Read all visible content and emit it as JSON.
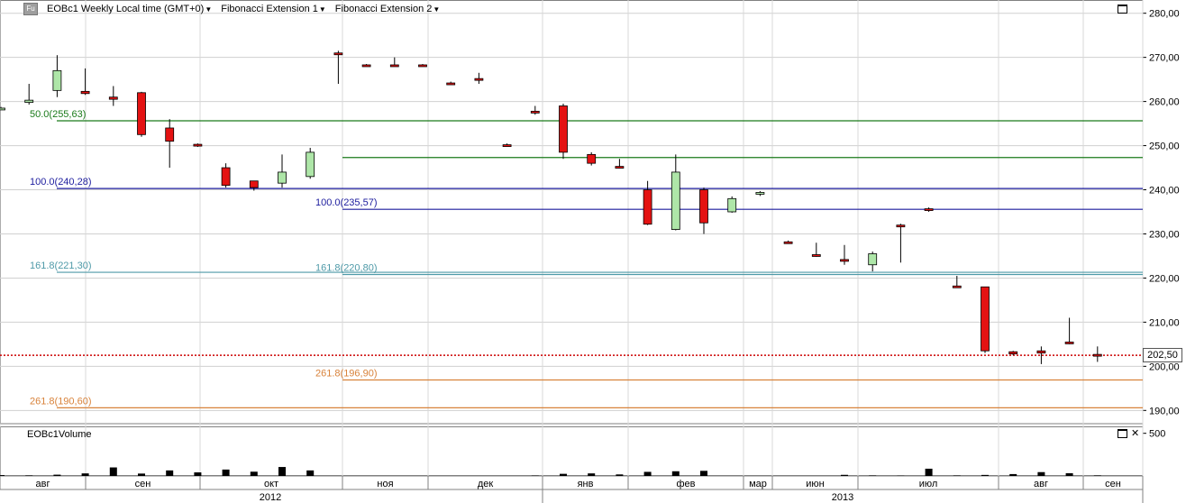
{
  "header": {
    "badge": "Fu",
    "symbol_title": "EOBc1 Weekly Local time (GMT+0)",
    "studies": [
      "Fibonacci Extension 1",
      "Fibonacci Extension 2"
    ]
  },
  "volume_title": "EOBc1Volume",
  "last_price_label": "202,50",
  "colors": {
    "up_fill": "#aee6a8",
    "down_fill": "#e41212",
    "fib50": "#1a7a1a",
    "fib100": "#1d1d9e",
    "fib161": "#4f9aa8",
    "fib261": "#d8823a",
    "last_price": "#cc0000",
    "grid": "#d0d0d0",
    "volume": "#000000"
  },
  "chart_data": {
    "type": "candlestick",
    "price_axis": {
      "ylim": [
        187,
        283
      ],
      "ticks": [
        "190,00",
        "200,00",
        "210,00",
        "220,00",
        "230,00",
        "240,00",
        "250,00",
        "260,00",
        "270,00",
        "280,00"
      ],
      "tick_values": [
        190,
        200,
        210,
        220,
        230,
        240,
        250,
        260,
        270,
        280
      ]
    },
    "volume_axis": {
      "ylim": [
        0,
        560
      ],
      "ticks": [
        "500"
      ],
      "tick_values": [
        500
      ]
    },
    "month_labels": [
      "авг",
      "сен",
      "окт",
      "ноя",
      "дек",
      "янв",
      "фев",
      "мар",
      "июн",
      "июл",
      "авг",
      "сен"
    ],
    "year_labels": [
      "2012",
      "2013"
    ],
    "candles": [
      {
        "o": 258.5,
        "h": 258.8,
        "l": 258.2,
        "c": 258.5,
        "v": 10
      },
      {
        "o": 259.8,
        "h": 264.0,
        "l": 259.3,
        "c": 260.3,
        "v": 5
      },
      {
        "o": 262.5,
        "h": 270.5,
        "l": 261.0,
        "c": 267.0,
        "v": 15
      },
      {
        "o": 262.3,
        "h": 267.5,
        "l": 261.5,
        "c": 261.8,
        "v": 30
      },
      {
        "o": 261.0,
        "h": 263.5,
        "l": 259.0,
        "c": 260.5,
        "v": 100
      },
      {
        "o": 262.0,
        "h": 262.2,
        "l": 252.0,
        "c": 252.5,
        "v": 28
      },
      {
        "o": 254.0,
        "h": 256.0,
        "l": 245.0,
        "c": 251.0,
        "v": 65
      },
      {
        "o": 250.3,
        "h": 250.5,
        "l": 249.7,
        "c": 249.9,
        "v": 42
      },
      {
        "o": 245.0,
        "h": 246.0,
        "l": 240.5,
        "c": 241.0,
        "v": 75
      },
      {
        "o": 242.0,
        "h": 242.0,
        "l": 239.8,
        "c": 240.5,
        "v": 50
      },
      {
        "o": 241.5,
        "h": 248.0,
        "l": 240.5,
        "c": 244.0,
        "v": 105
      },
      {
        "o": 243.0,
        "h": 249.5,
        "l": 242.5,
        "c": 248.5,
        "v": 65
      },
      {
        "o": 271.0,
        "h": 271.5,
        "l": 264.0,
        "c": 270.8,
        "v": 0
      },
      {
        "o": 268.3,
        "h": 268.5,
        "l": 268.0,
        "c": 268.1,
        "v": 0
      },
      {
        "o": 268.3,
        "h": 270.0,
        "l": 268.0,
        "c": 268.1,
        "v": 0
      },
      {
        "o": 268.3,
        "h": 268.5,
        "l": 268.0,
        "c": 268.1,
        "v": 0
      },
      {
        "o": 264.2,
        "h": 264.5,
        "l": 264.0,
        "c": 264.0,
        "v": 0
      },
      {
        "o": 265.2,
        "h": 266.5,
        "l": 264.0,
        "c": 265.0,
        "v": 0
      },
      {
        "o": 250.2,
        "h": 250.5,
        "l": 250.0,
        "c": 250.0,
        "v": 0
      },
      {
        "o": 257.8,
        "h": 259.0,
        "l": 257.0,
        "c": 257.5,
        "v": 3
      },
      {
        "o": 259.0,
        "h": 259.5,
        "l": 247.0,
        "c": 248.5,
        "v": 25
      },
      {
        "o": 248.0,
        "h": 248.5,
        "l": 245.5,
        "c": 246.0,
        "v": 30
      },
      {
        "o": 245.3,
        "h": 247.0,
        "l": 244.8,
        "c": 245.0,
        "v": 18
      },
      {
        "o": 240.0,
        "h": 242.0,
        "l": 232.0,
        "c": 232.2,
        "v": 48
      },
      {
        "o": 231.0,
        "h": 248.0,
        "l": 230.8,
        "c": 244.0,
        "v": 55
      },
      {
        "o": 240.0,
        "h": 240.5,
        "l": 230.0,
        "c": 232.5,
        "v": 60
      },
      {
        "o": 235.0,
        "h": 238.5,
        "l": 234.8,
        "c": 238.0,
        "v": 0
      },
      {
        "o": 239.0,
        "h": 239.7,
        "l": 238.6,
        "c": 239.4,
        "v": 0
      },
      {
        "o": 228.2,
        "h": 228.5,
        "l": 227.8,
        "c": 228.0,
        "v": 0
      },
      {
        "o": 225.3,
        "h": 228.0,
        "l": 224.8,
        "c": 225.0,
        "v": 0
      },
      {
        "o": 224.2,
        "h": 227.5,
        "l": 223.0,
        "c": 224.0,
        "v": 13
      },
      {
        "o": 223.0,
        "h": 226.0,
        "l": 221.5,
        "c": 225.5,
        "v": 4
      },
      {
        "o": 232.0,
        "h": 232.3,
        "l": 223.5,
        "c": 231.8,
        "v": 2
      },
      {
        "o": 235.7,
        "h": 236.0,
        "l": 235.0,
        "c": 235.4,
        "v": 85
      },
      {
        "o": 218.2,
        "h": 220.5,
        "l": 217.8,
        "c": 218.0,
        "v": 4
      },
      {
        "o": 218.0,
        "h": 218.0,
        "l": 203.0,
        "c": 203.5,
        "v": 12
      },
      {
        "o": 203.3,
        "h": 203.5,
        "l": 202.5,
        "c": 202.8,
        "v": 22
      },
      {
        "o": 203.5,
        "h": 204.5,
        "l": 200.5,
        "c": 203.0,
        "v": 45
      },
      {
        "o": 205.5,
        "h": 211.0,
        "l": 205.0,
        "c": 205.2,
        "v": 32
      },
      {
        "o": 202.7,
        "h": 204.5,
        "l": 201.0,
        "c": 202.5,
        "v": 5
      }
    ],
    "fib_levels": [
      {
        "label": "50.0(255,63)",
        "value": 255.63,
        "color_key": "fib50",
        "from": 0.0,
        "to": 1.0
      },
      {
        "label": "",
        "value": 247.3,
        "color_key": "fib50",
        "from": 0.28,
        "to": 1.0
      },
      {
        "label": "100.0(240,28)",
        "value": 240.28,
        "color_key": "fib100",
        "from": 0.0,
        "to": 1.0
      },
      {
        "label": "100.0(235,57)",
        "value": 235.57,
        "color_key": "fib100",
        "from": 0.28,
        "to": 1.0
      },
      {
        "label": "161.8(221,30)",
        "value": 221.3,
        "color_key": "fib161",
        "from": 0.0,
        "to": 1.0
      },
      {
        "label": "161.8(220,80)",
        "value": 220.8,
        "color_key": "fib161",
        "from": 0.28,
        "to": 1.0
      },
      {
        "label": "261.8(196,90)",
        "value": 196.9,
        "color_key": "fib261",
        "from": 0.28,
        "to": 1.0
      },
      {
        "label": "261.8(190,60)",
        "value": 190.6,
        "color_key": "fib261",
        "from": 0.0,
        "to": 1.0
      }
    ],
    "last_price": 202.5
  }
}
